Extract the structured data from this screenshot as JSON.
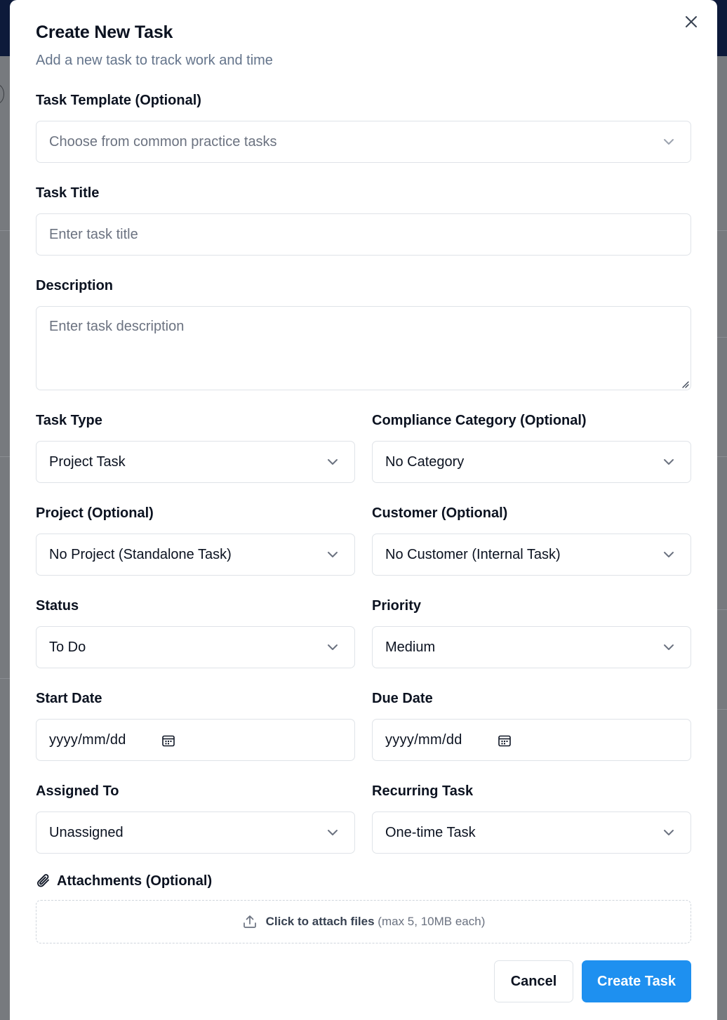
{
  "modal": {
    "title": "Create New Task",
    "subtitle": "Add a new task to track work and time"
  },
  "fields": {
    "template": {
      "label": "Task Template (Optional)",
      "placeholder": "Choose from common practice tasks"
    },
    "title": {
      "label": "Task Title",
      "placeholder": "Enter task title"
    },
    "description": {
      "label": "Description",
      "placeholder": "Enter task description"
    },
    "task_type": {
      "label": "Task Type",
      "value": "Project Task"
    },
    "compliance": {
      "label": "Compliance Category (Optional)",
      "value": "No Category"
    },
    "project": {
      "label": "Project (Optional)",
      "value": "No Project (Standalone Task)"
    },
    "customer": {
      "label": "Customer (Optional)",
      "value": "No Customer (Internal Task)"
    },
    "status": {
      "label": "Status",
      "value": "To Do"
    },
    "priority": {
      "label": "Priority",
      "value": "Medium"
    },
    "start_date": {
      "label": "Start Date",
      "placeholder": "yyyy/mm/dd"
    },
    "due_date": {
      "label": "Due Date",
      "placeholder": "yyyy/mm/dd"
    },
    "assigned_to": {
      "label": "Assigned To",
      "value": "Unassigned"
    },
    "recurring": {
      "label": "Recurring Task",
      "value": "One-time Task"
    }
  },
  "attachments": {
    "label": "Attachments (Optional)",
    "action": "Click to attach files",
    "hint": "(max 5, 10MB each)"
  },
  "buttons": {
    "cancel": "Cancel",
    "create": "Create Task"
  },
  "colors": {
    "primary": "#1e90f0",
    "border": "#dfe3e8",
    "placeholder": "#6b7280",
    "text": "#0b1220"
  },
  "icons": [
    "close-icon",
    "chevron-down-icon",
    "calendar-icon",
    "paperclip-icon",
    "upload-icon",
    "resize-handle-icon"
  ]
}
